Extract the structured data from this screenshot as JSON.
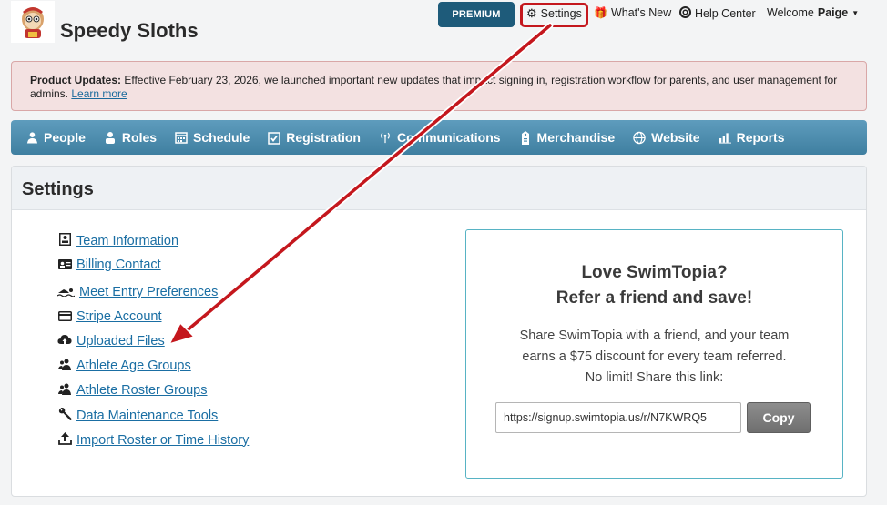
{
  "header": {
    "brand": "Speedy Sloths",
    "premium_label": "PREMIUM",
    "settings_label": "Settings",
    "whats_new_label": "What's New",
    "help_center_label": "Help Center",
    "welcome_prefix": "Welcome",
    "welcome_user": "Paige"
  },
  "banner": {
    "title": "Product Updates:",
    "text": " Effective February 23, 2026, we launched important new updates that impact signing in, registration workflow for parents, and user management for admins. ",
    "link": "Learn more"
  },
  "mainnav": [
    {
      "label": "People",
      "icon": "people-icon"
    },
    {
      "label": "Roles",
      "icon": "roles-icon"
    },
    {
      "label": "Schedule",
      "icon": "calendar-icon"
    },
    {
      "label": "Registration",
      "icon": "checklist-icon"
    },
    {
      "label": "Communications",
      "icon": "broadcast-icon"
    },
    {
      "label": "Merchandise",
      "icon": "tag-icon"
    },
    {
      "label": "Website",
      "icon": "globe-icon"
    },
    {
      "label": "Reports",
      "icon": "bar-chart-icon"
    }
  ],
  "settings": {
    "title": "Settings",
    "links": [
      {
        "label": "Team Information",
        "icon": "id-badge-icon"
      },
      {
        "label": "Billing Contact",
        "icon": "id-card-icon"
      },
      {
        "label": "Meet Entry Preferences",
        "icon": "swimmer-icon"
      },
      {
        "label": "Stripe Account",
        "icon": "credit-card-icon"
      },
      {
        "label": "Uploaded Files",
        "icon": "cloud-upload-icon"
      },
      {
        "label": "Athlete Age Groups",
        "icon": "athletes-icon"
      },
      {
        "label": "Athlete Roster Groups",
        "icon": "athletes-icon"
      },
      {
        "label": "Data Maintenance Tools",
        "icon": "wrench-icon"
      },
      {
        "label": "Import Roster or Time History",
        "icon": "upload-icon"
      }
    ]
  },
  "referral": {
    "title_line1": "Love SwimTopia?",
    "title_line2": "Refer a friend and save!",
    "text_line1": "Share SwimTopia with a friend, and your team",
    "text_line2": "earns a $75 discount for every team referred.",
    "text_line3": "No limit! Share this link:",
    "link_value": "https://signup.swimtopia.us/r/N7KWRQ5",
    "copy_label": "Copy"
  },
  "colors": {
    "accent": "#1e5b7a",
    "nav": "#4a8bad",
    "highlight": "#c4171d",
    "link": "#1a6ea3"
  }
}
